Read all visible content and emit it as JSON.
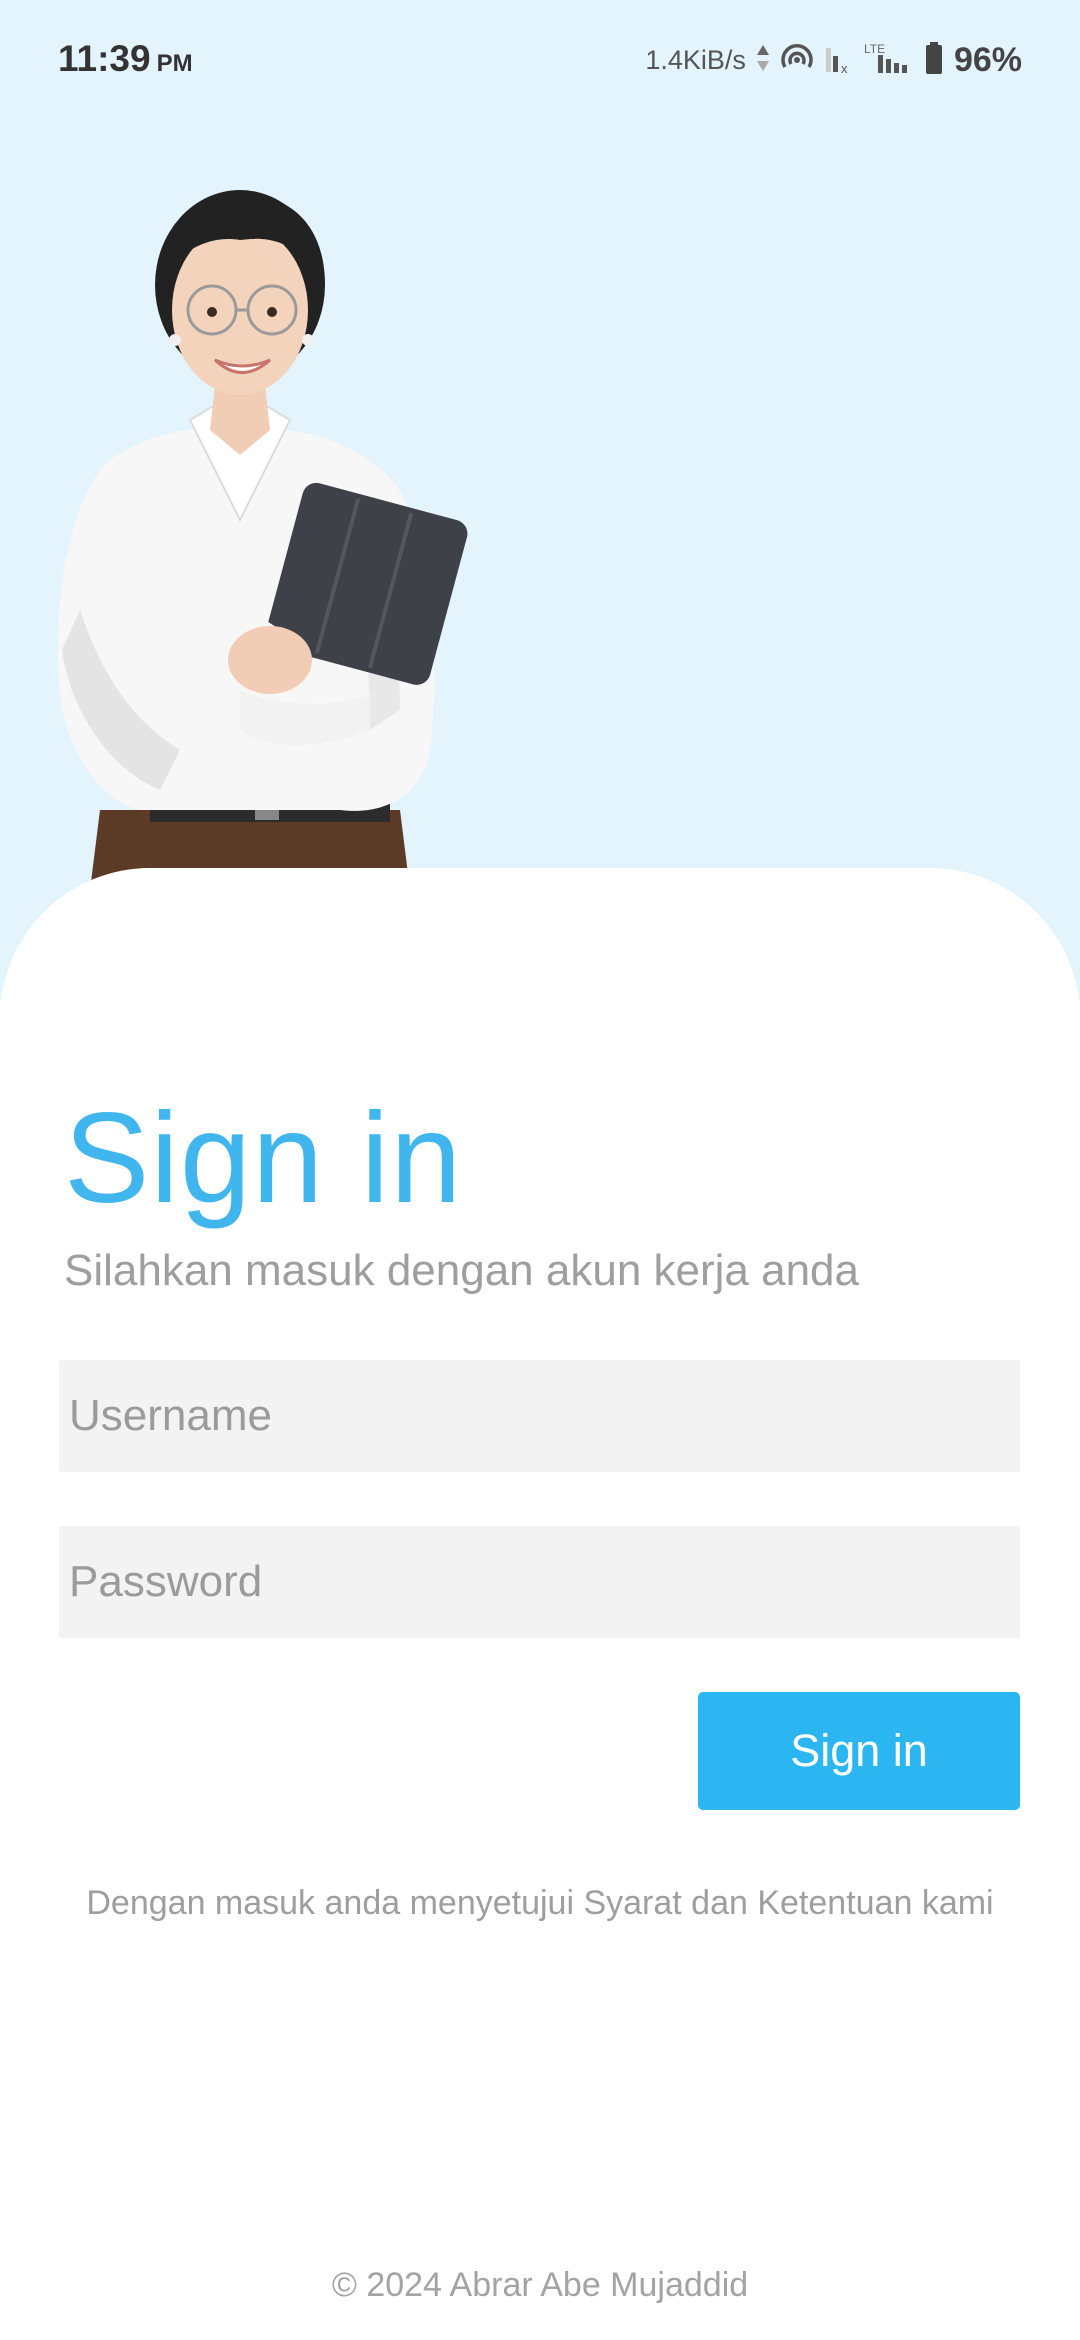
{
  "status_bar": {
    "time": "11:39",
    "ampm": "PM",
    "net_speed": "1.4KiB/s",
    "battery": "96%",
    "icons": [
      "data-arrows-icon",
      "hotspot-icon",
      "sim-muted-icon",
      "lte-signal-icon",
      "battery-icon"
    ]
  },
  "hero": {
    "image": "woman-with-tablet-illustration"
  },
  "login": {
    "title": "Sign in",
    "subtitle": "Silahkan masuk dengan akun kerja anda",
    "username_placeholder": "Username",
    "password_placeholder": "Password",
    "button_label": "Sign in",
    "terms_text": "Dengan masuk anda menyetujui Syarat dan Ketentuan kami"
  },
  "footer": {
    "copyright": "© 2024 Abrar Abe Mujaddid"
  },
  "colors": {
    "hero_bg": "#e3f4fd",
    "accent": "#41b6ee",
    "button": "#2bb6f2",
    "input_bg": "#f3f3f3"
  }
}
